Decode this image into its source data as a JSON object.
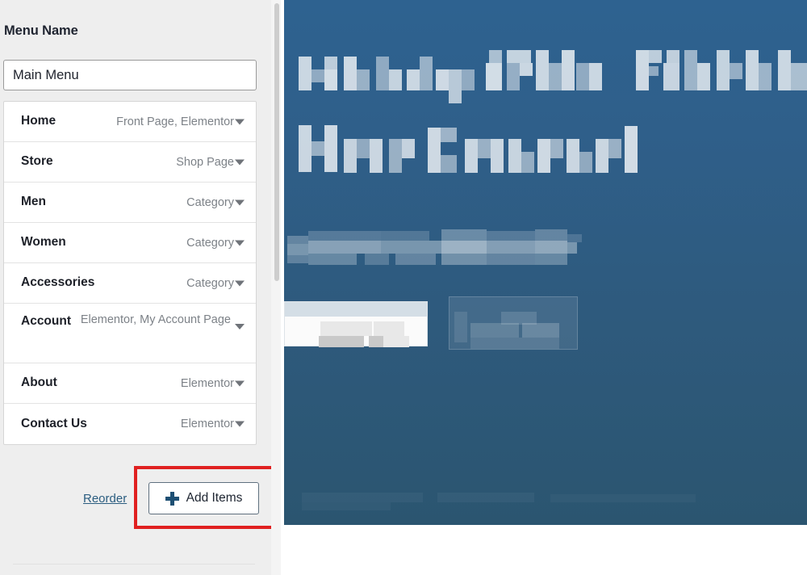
{
  "left_panel": {
    "label": "Menu Name",
    "menu_name_input": {
      "value": "Main Menu",
      "placeholder": "Enter menu name"
    },
    "menu_items": [
      {
        "title": "Home",
        "meta": "Front Page, Elementor"
      },
      {
        "title": "Store",
        "meta": "Shop Page"
      },
      {
        "title": "Men",
        "meta": "Category"
      },
      {
        "title": "Women",
        "meta": "Category"
      },
      {
        "title": "Accessories",
        "meta": "Category"
      },
      {
        "title": "Account",
        "meta": "Elementor, My Account Page"
      },
      {
        "title": "About",
        "meta": "Elementor"
      },
      {
        "title": "Contact Us",
        "meta": "Elementor"
      }
    ],
    "actions": {
      "reorder_label": "Reorder",
      "add_items_label": "Add Items",
      "add_items_icon": "plus-icon"
    },
    "highlight_color": "#e02020"
  },
  "preview": {
    "hero_background_color": "#2e5a7d",
    "censored": true,
    "censored_note": "",
    "hero_lines": [
      {
        "id": "headline-line-1",
        "text": ""
      },
      {
        "id": "headline-line-2",
        "text": ""
      },
      {
        "id": "subtext-line",
        "text": ""
      }
    ],
    "hero_buttons": [
      {
        "id": "primary-button",
        "text": ""
      },
      {
        "id": "secondary-button",
        "text": ""
      }
    ]
  }
}
